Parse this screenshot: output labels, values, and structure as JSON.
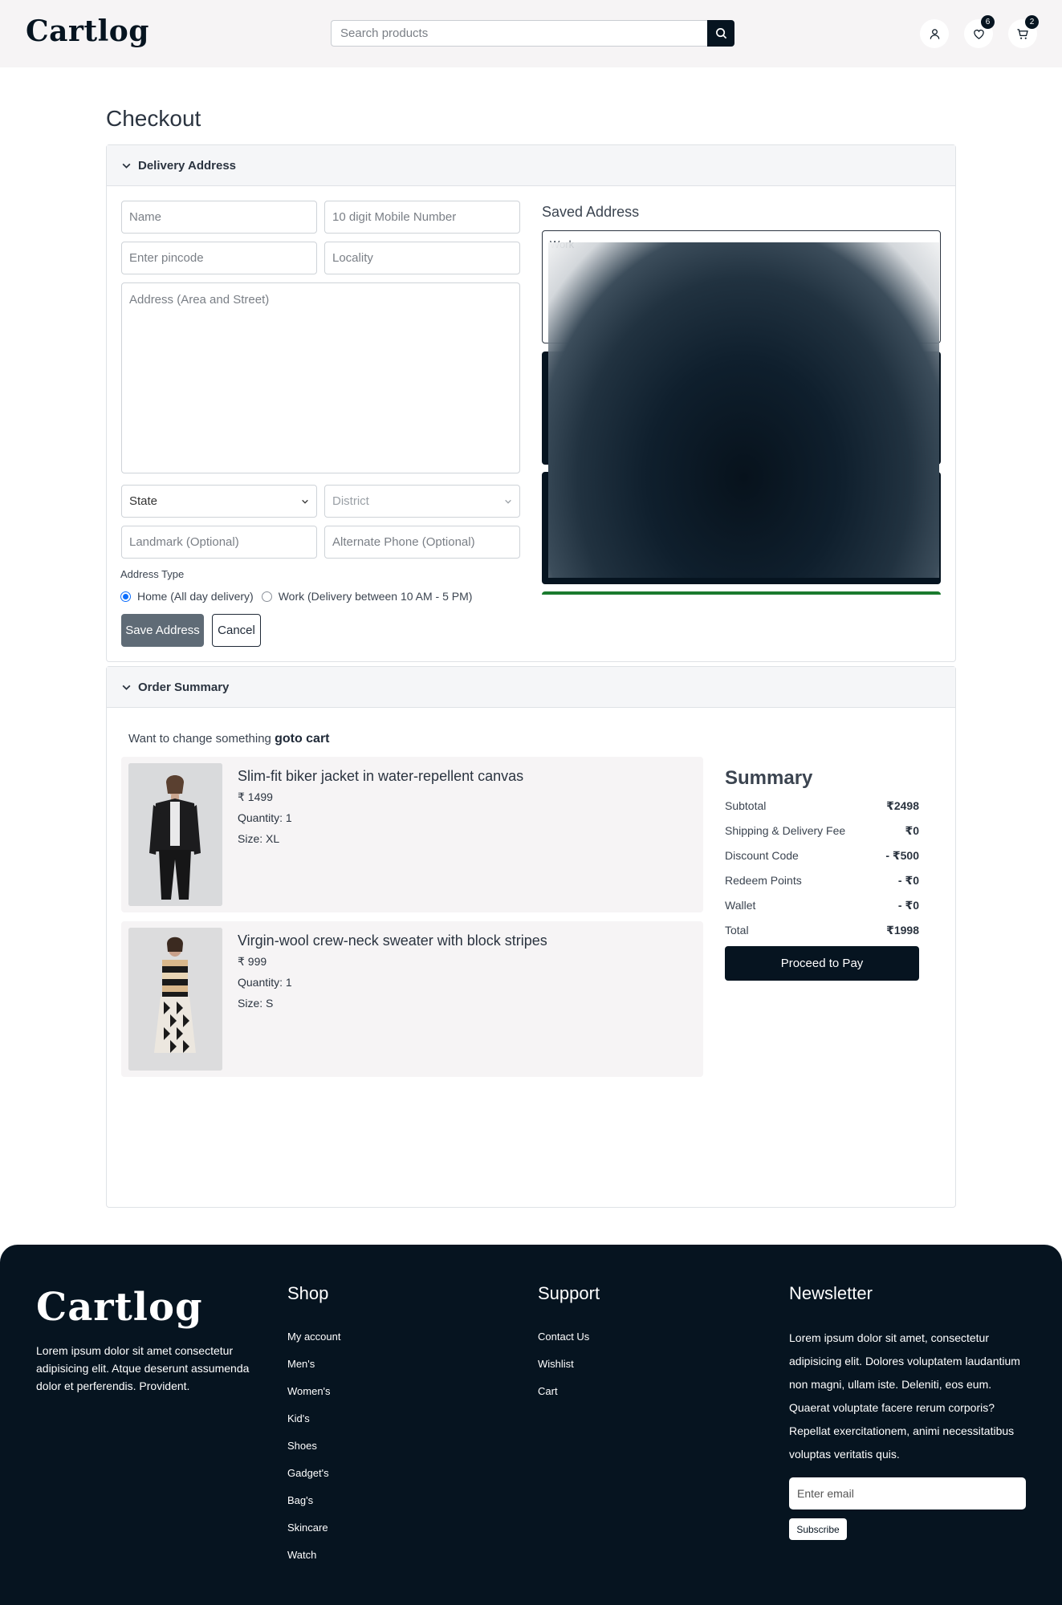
{
  "header": {
    "logo": "Cartlog",
    "search_placeholder": "Search products",
    "wishlist_count": "6",
    "cart_count": "2"
  },
  "page_title": "Checkout",
  "delivery": {
    "title": "Delivery Address",
    "name_placeholder": "Name",
    "mobile_placeholder": "10 digit Mobile Number",
    "pincode_placeholder": "Enter pincode",
    "locality_placeholder": "Locality",
    "address_placeholder": "Address (Area and Street)",
    "state_value": "State",
    "district_value": "District",
    "landmark_placeholder": "Landmark (Optional)",
    "alt_phone_placeholder": "Alternate Phone (Optional)",
    "address_type_label": "Address Type",
    "home_option": "Home (All day delivery)",
    "work_option": "Work (Delivery between 10 AM - 5 PM)",
    "save_label": "Save Address",
    "cancel_label": "Cancel",
    "saved_title": "Saved Address",
    "saved_first_label": "Work"
  },
  "order": {
    "title": "Order Summary",
    "change_text": "Want to change something",
    "goto_cart": "goto cart",
    "items": [
      {
        "name": "Slim-fit biker jacket in water-repellent canvas",
        "price": "₹ 1499",
        "quantity": "Quantity: 1",
        "size": "Size: XL"
      },
      {
        "name": "Virgin-wool crew-neck sweater with block stripes",
        "price": "₹ 999",
        "quantity": "Quantity: 1",
        "size": "Size: S"
      }
    ]
  },
  "summary": {
    "title": "Summary",
    "rows": [
      {
        "label": "Subtotal",
        "value": "₹2498"
      },
      {
        "label": "Shipping & Delivery Fee",
        "value": "₹0"
      },
      {
        "label": "Discount Code",
        "value": "- ₹500"
      },
      {
        "label": "Redeem Points",
        "value": "- ₹0"
      },
      {
        "label": "Wallet",
        "value": "- ₹0"
      },
      {
        "label": "Total",
        "value": "₹1998"
      }
    ],
    "pay_label": "Proceed to Pay"
  },
  "footer": {
    "logo": "Cartlog",
    "about": "Lorem ipsum dolor sit amet consectetur adipisicing elit. Atque deserunt assumenda dolor et perferendis. Provident.",
    "shop_title": "Shop",
    "shop_links": [
      "My account",
      "Men's",
      "Women's",
      "Kid's",
      "Shoes",
      "Gadget's",
      "Bag's",
      "Skincare",
      "Watch"
    ],
    "support_title": "Support",
    "support_links": [
      "Contact Us",
      "Wishlist",
      "Cart"
    ],
    "newsletter_title": "Newsletter",
    "newsletter_text": "Lorem ipsum dolor sit amet, consectetur adipisicing elit. Dolores voluptatem laudantium non magni, ullam iste. Deleniti, eos eum. Quaerat voluptate facere rerum corporis? Repellat exercitationem, animi necessitatibus voluptas veritatis quis.",
    "email_placeholder": "Enter email",
    "subscribe_label": "Subscribe"
  },
  "colors": {
    "brand_dark": "#061420",
    "header_bg": "#f6f4f5",
    "radio_accent": "#0d6efd",
    "saved_accent": "#1a7a2e"
  }
}
